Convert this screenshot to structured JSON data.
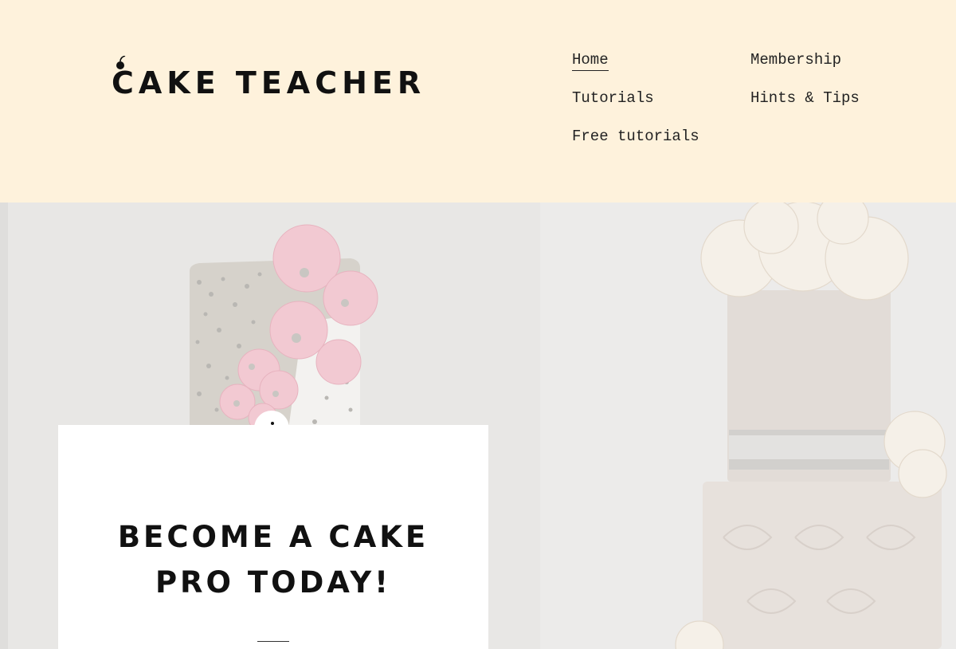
{
  "brand": {
    "name": "CAKE TEACHER",
    "logo_icon": "cherry-icon"
  },
  "nav": {
    "home": "Home",
    "membership": "Membership",
    "tutorials": "Tutorials",
    "hints_tips": "Hints & Tips",
    "free_tutorials": "Free tutorials",
    "active": "Home"
  },
  "hero": {
    "headline_line1": "BECOME A CAKE",
    "headline_line2": "PRO TODAY!"
  },
  "colors": {
    "header_bg": "#fef2dc",
    "card_bg": "#ffffff",
    "text": "#111111",
    "flower_pink": "#f2c9d2",
    "cake_grey": "#d9d5cf"
  }
}
